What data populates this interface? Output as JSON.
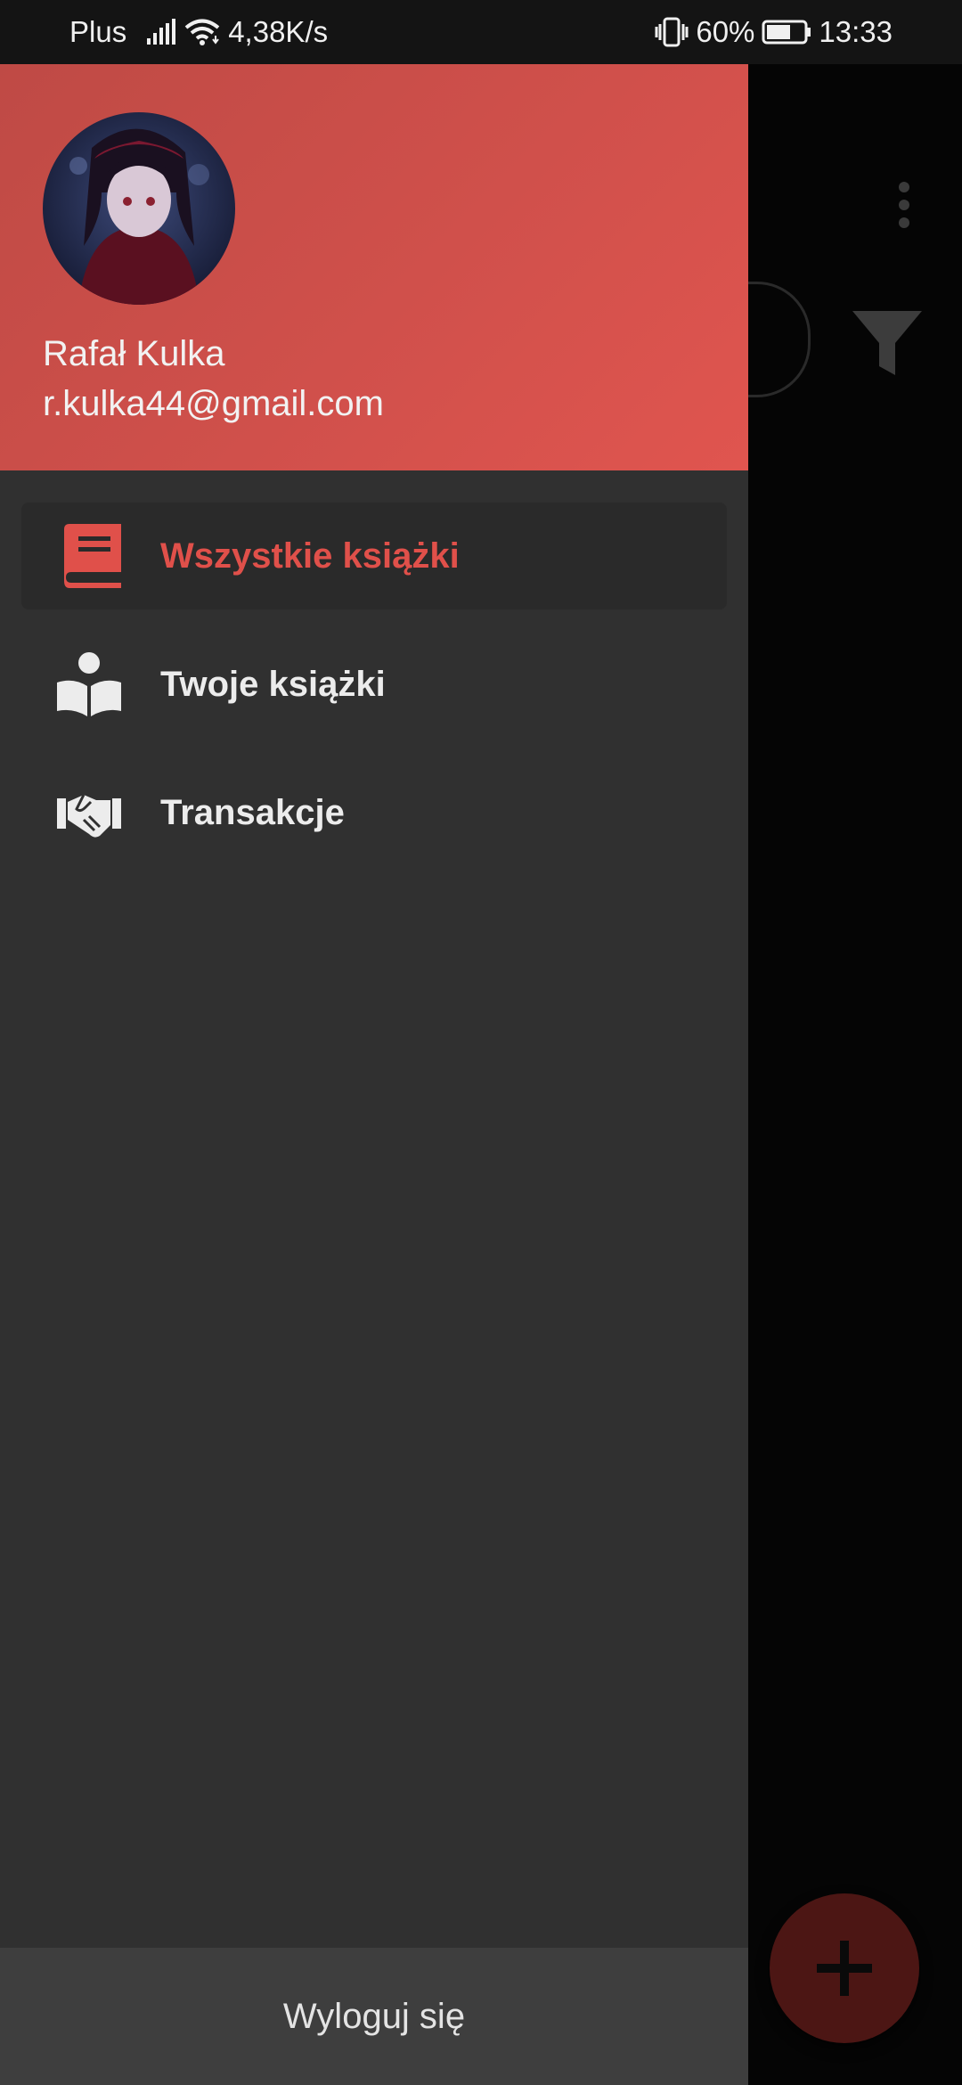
{
  "status_bar": {
    "carrier": "Plus",
    "speed": "4,38K/s",
    "battery": "60%",
    "time": "13:33"
  },
  "drawer": {
    "user": {
      "name": "Rafał Kulka",
      "email": "r.kulka44@gmail.com"
    },
    "items": [
      {
        "label": "Wszystkie książki",
        "icon": "book-icon",
        "active": true
      },
      {
        "label": "Twoje książki",
        "icon": "reader-icon",
        "active": false
      },
      {
        "label": "Transakcje",
        "icon": "handshake-icon",
        "active": false
      }
    ],
    "logout_label": "Wyloguj się"
  },
  "colors": {
    "accent": "#e0504a",
    "header": "#d0504b",
    "drawer_bg": "#303030",
    "logout_bg": "#3e3e3e",
    "fab": "#4c1614"
  }
}
